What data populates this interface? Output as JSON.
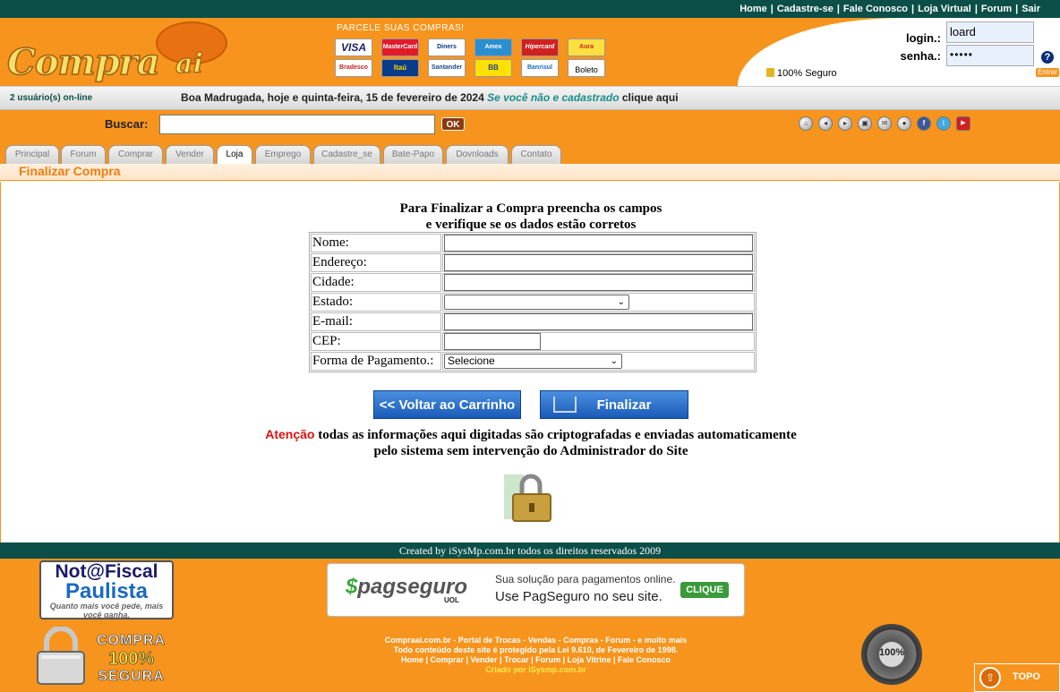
{
  "topnav": {
    "items": [
      "Home",
      "Cadastre-se",
      "Fale Conosco",
      "Loja Virtual",
      "Forum",
      "Sair"
    ],
    "separator": "|"
  },
  "header": {
    "logo_main": "Compra",
    "logo_suffix": "ai",
    "installments_label": "PARCELE SUAS COMPRAS!",
    "cards": [
      "VISA",
      "MasterCard",
      "Diners",
      "Amex",
      "Hipercard",
      "Aura",
      "Bradesco",
      "Itaú",
      "Santander",
      "BB",
      "Banrisul",
      "Boleto"
    ],
    "secure_label": "100% Seguro",
    "login_label": "login.:",
    "login_value": "loard",
    "password_label": "senha.:",
    "password_value": "•••••",
    "help_icon": "?",
    "enter_label": "Entrar"
  },
  "status": {
    "online": "2  usuário(s) on-line",
    "greeting": "Boa Madrugada, hoje e quinta-feira, 15 de fevereiro de 2024",
    "not_registered": "Se você não e cadastrado",
    "click_here": "clique aqui"
  },
  "search": {
    "label": "Buscar:",
    "value": "",
    "button": "OK",
    "icons": [
      "home-icon",
      "back-icon",
      "forward-icon",
      "cart-icon",
      "mail-icon",
      "chat-icon",
      "facebook-icon",
      "twitter-icon",
      "youtube-icon"
    ]
  },
  "tabs": [
    "Principal",
    "Forum",
    "Comprar",
    "Vender",
    "Loja",
    "Emprego",
    "Cadastre_se",
    "Bate-Papo",
    "Dovnloads",
    "Contato"
  ],
  "active_tab": "Loja",
  "page_title": "Finalizar Compra",
  "form": {
    "intro_line1": "Para Finalizar a Compra preencha os campos",
    "intro_line2": "e verifique se os dados estão corretos",
    "labels": {
      "nome": "Nome:",
      "endereco": "Endereço:",
      "cidade": "Cidade:",
      "estado": "Estado:",
      "email": "E-mail:",
      "cep": "CEP:",
      "pagamento": "Forma de Pagamento.:"
    },
    "estado_value": "",
    "pagamento_value": "Selecione",
    "back_button": "<< Voltar ao Carrinho",
    "finish_button": "Finalizar"
  },
  "warning": {
    "attention": "Atenção",
    "line1": "todas as informações aqui digitadas são criptografadas e enviadas automaticamente",
    "line2": "pelo sistema sem intervenção do Administrador do Site"
  },
  "footer": {
    "credit": "Created by iSysMp.com.br todos os direitos reservados 2009",
    "nota_fiscal_line1": "Not@Fiscal",
    "nota_fiscal_line2": "Paulista",
    "nota_fiscal_slogan": "Quanto mais você pede, mais você ganha.",
    "pagseguro_brand": "pagseguro",
    "pagseguro_uol": "UOL",
    "pagseguro_line1": "Sua solução para pagamentos online.",
    "pagseguro_line2": "Use PagSeguro no seu site.",
    "pagseguro_button": "CLIQUE",
    "compra_segura_1": "COMPRA",
    "compra_segura_2": "100%",
    "compra_segura_3": "SEGURA",
    "links_line1": "Compraai.com.br - Portal de Trocas - Vendas - Compras - Forum - e muito mais",
    "links_line2": "Todo conteúdo deste site é protegido pela Lei 9.610, de Fevereiro de 1998.",
    "links_line3": "Home | Comprar | Vender | Trocar | Forum | Loja Vitrine | Fale Conosco",
    "links_line4": "Criado por iSysmp.com.br",
    "seal_value": "100%",
    "topo_label": "TOPO"
  }
}
